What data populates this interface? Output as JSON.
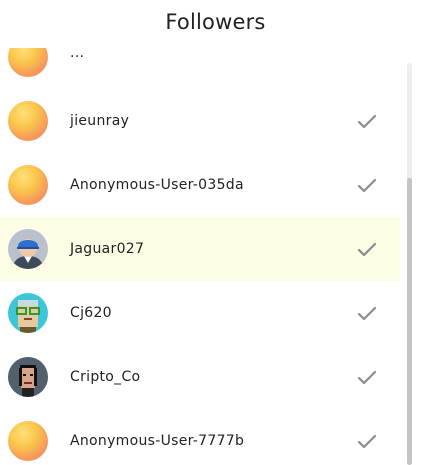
{
  "header": {
    "title": "Followers"
  },
  "followers": [
    {
      "name": "...",
      "avatar": "default-gradient"
    },
    {
      "name": "jieunray",
      "avatar": "default-gradient"
    },
    {
      "name": "Anonymous-User-035da",
      "avatar": "default-gradient"
    },
    {
      "name": "Jaguar027",
      "avatar": "person-cap-avatar"
    },
    {
      "name": "Cj620",
      "avatar": "pixel-glasses-avatar"
    },
    {
      "name": "Cripto_Co",
      "avatar": "pixel-punk-avatar"
    },
    {
      "name": "Anonymous-User-7777b",
      "avatar": "default-gradient"
    }
  ],
  "status_icon": "check-icon",
  "colors": {
    "highlight": "#fdfde5",
    "check": "#8c8c8c"
  }
}
